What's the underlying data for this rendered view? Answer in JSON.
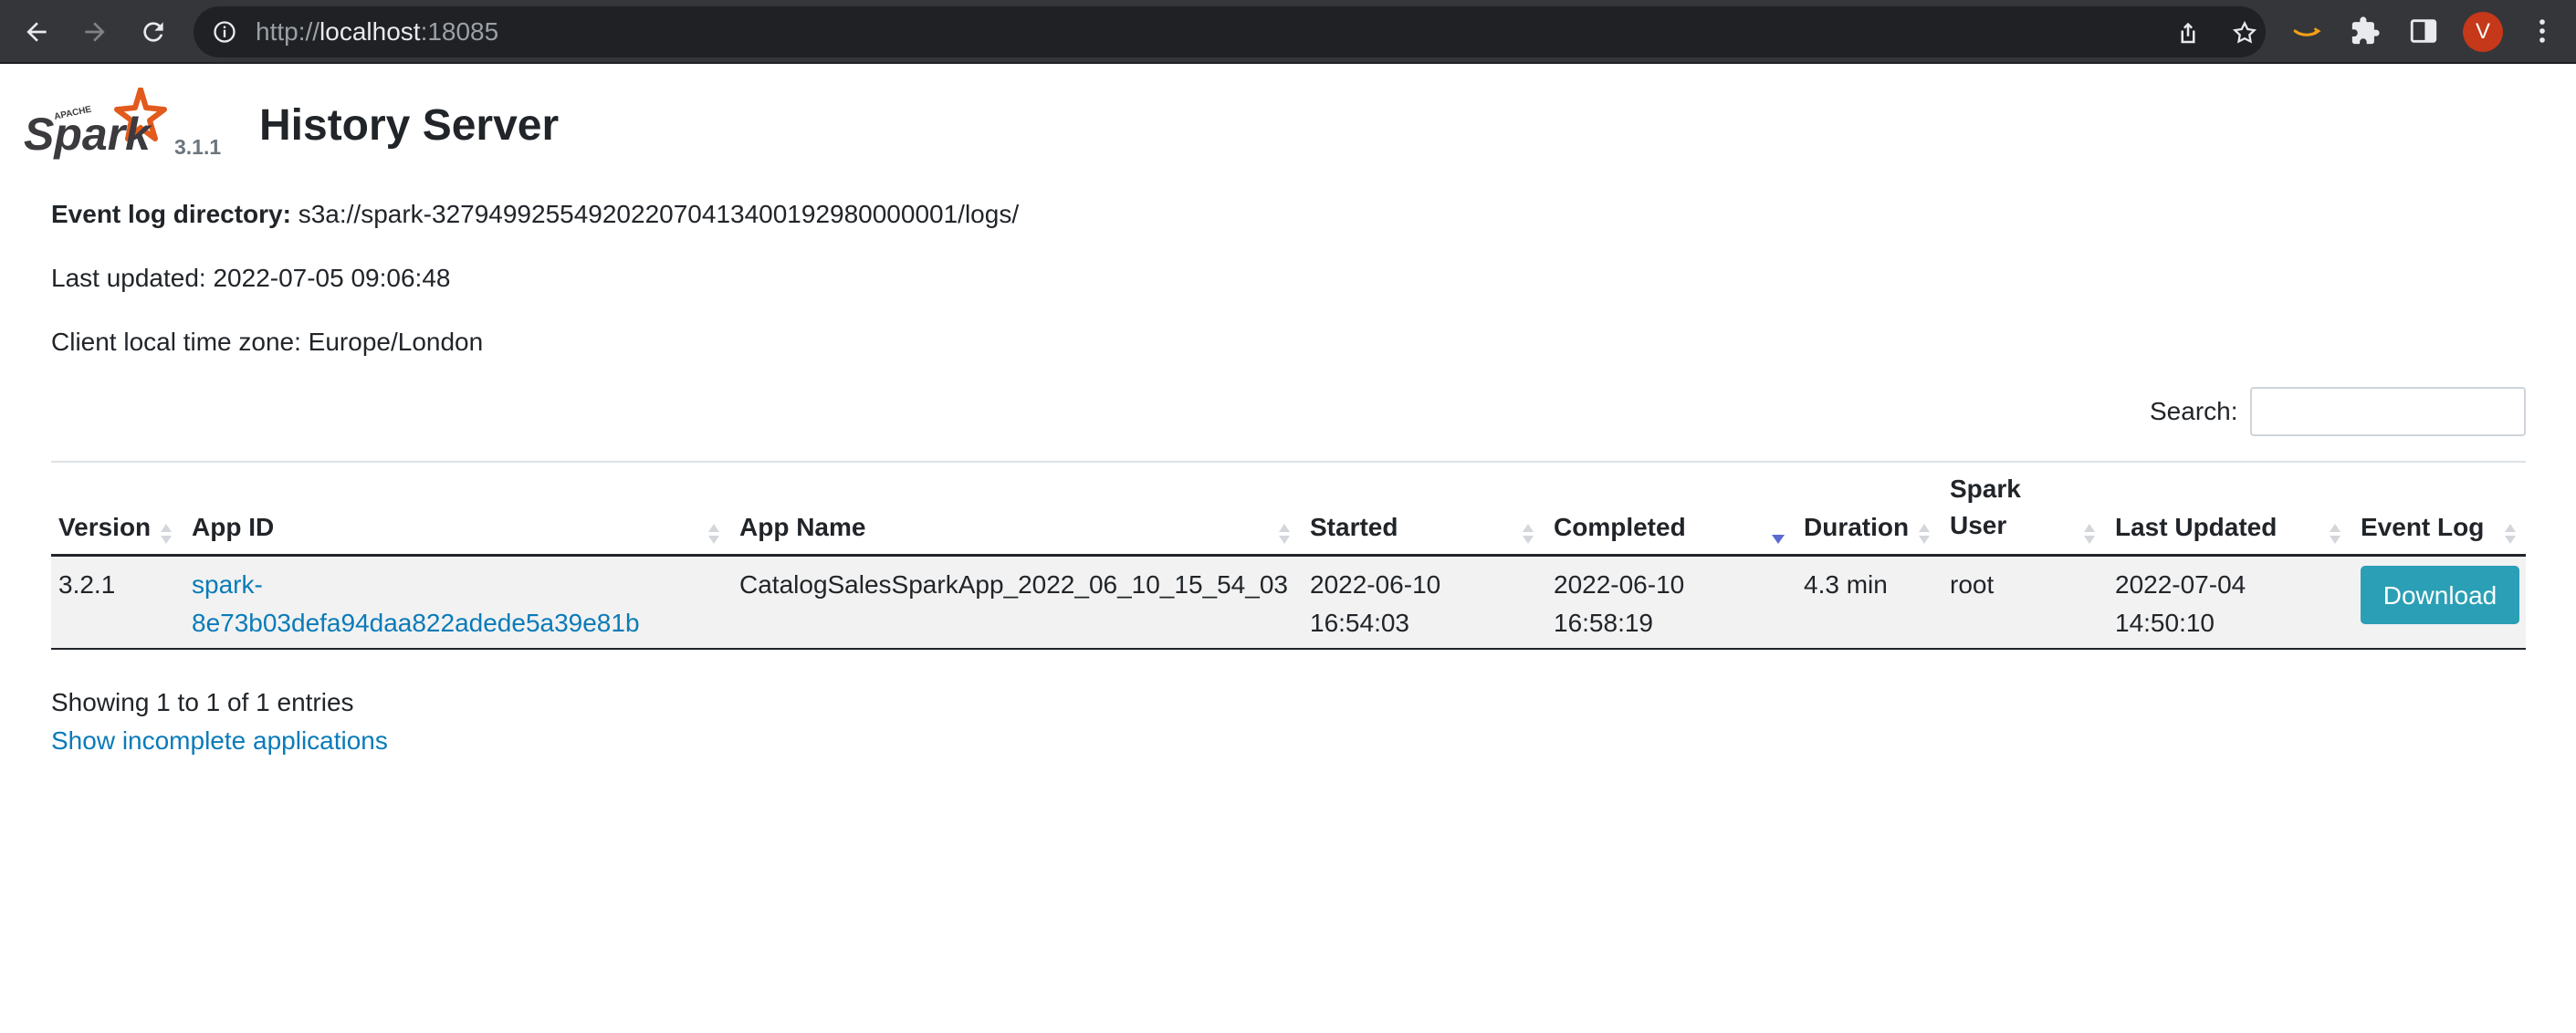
{
  "browser": {
    "url_scheme": "http://",
    "url_host": "localhost",
    "url_port": ":18085",
    "avatar_letter": "V"
  },
  "header": {
    "logo_text": "Spark",
    "logo_small_text": "APACHE",
    "spark_version": "3.1.1",
    "title": "History Server"
  },
  "info": {
    "event_log_label": "Event log directory:",
    "event_log_value": "s3a://spark-3279499255492022070413400192980000001/logs/",
    "last_updated": "Last updated: 2022-07-05 09:06:48",
    "time_zone": "Client local time zone: Europe/London"
  },
  "search": {
    "label": "Search:",
    "value": "",
    "placeholder": ""
  },
  "table": {
    "columns": {
      "version": "Version",
      "app_id": "App ID",
      "app_name": "App Name",
      "started": "Started",
      "completed": "Completed",
      "duration": "Duration",
      "spark_user_1": "Spark",
      "spark_user_2": "User",
      "last_updated": "Last Updated",
      "event_log": "Event Log"
    },
    "sorted_column": "Completed",
    "sort_direction": "descending",
    "rows": [
      {
        "version": "3.2.1",
        "app_id_1": "spark-",
        "app_id_2": "8e73b03defa94daa822adede5a39e81b",
        "app_name": "CatalogSalesSparkApp_2022_06_10_15_54_03",
        "started_date": "2022-06-10",
        "started_time": "16:54:03",
        "completed_date": "2022-06-10",
        "completed_time": "16:58:19",
        "duration": "4.3 min",
        "spark_user": "root",
        "last_updated_date": "2022-07-04",
        "last_updated_time": "14:50:10",
        "event_log_button": "Download"
      }
    ]
  },
  "footer": {
    "showing": "Showing 1 to 1 of 1 entries",
    "incomplete_link": "Show incomplete applications"
  },
  "colors": {
    "link": "#0a7bb8",
    "button": "#2a9fb5",
    "logo_orange": "#e25a1c",
    "logo_dark": "#3c3a3e",
    "sort_active": "#5b6ad0"
  }
}
